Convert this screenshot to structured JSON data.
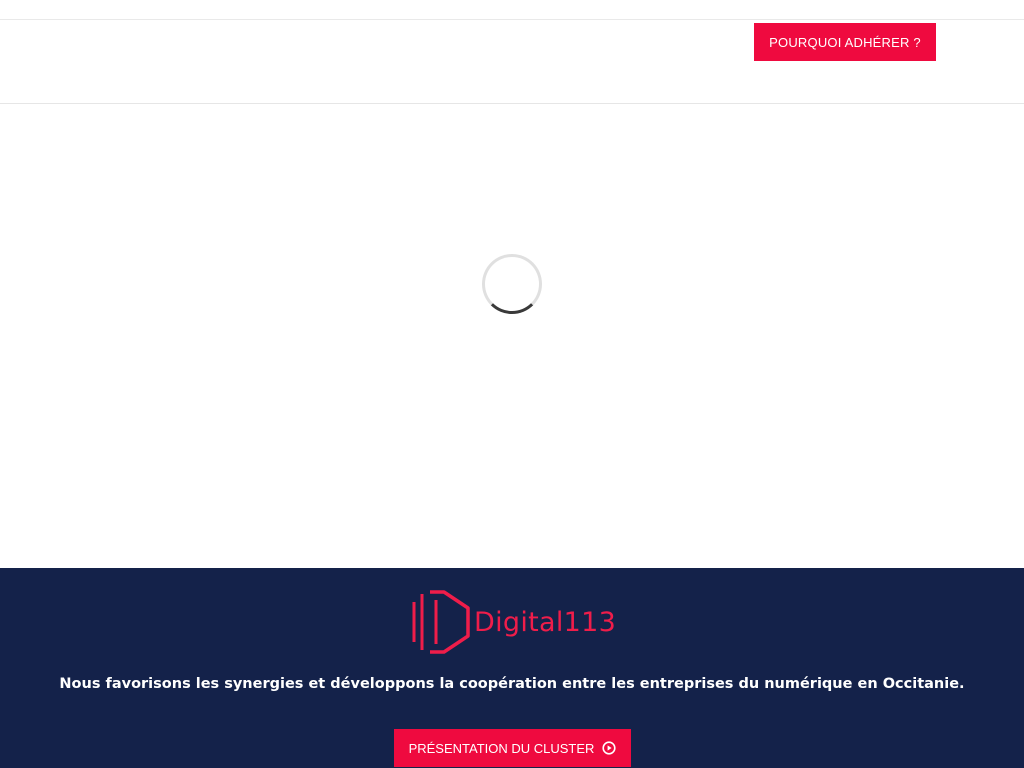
{
  "header": {
    "cta_label": "POURQUOI ADHÉRER ?"
  },
  "main": {
    "loading": true
  },
  "footer": {
    "logo_text": "Digital113",
    "tagline": "Nous favorisons les synergies et développons la coopération entre les entreprises du numérique en Occitanie.",
    "button_label": "PRÉSENTATION DU CLUSTER",
    "button_icon": "play-circle-icon"
  },
  "colors": {
    "accent": "#ef0a3f",
    "footer_bg": "#14224a",
    "logo": "#ef1d4a"
  }
}
